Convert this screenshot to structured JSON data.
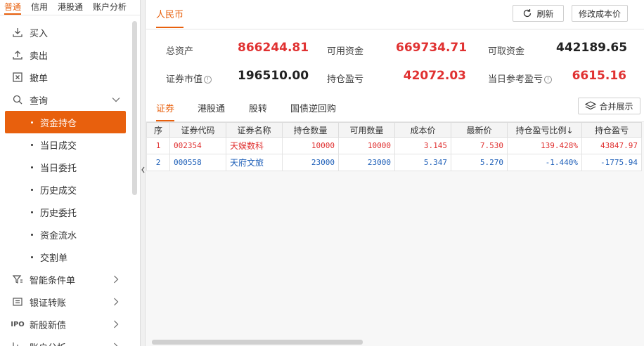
{
  "sidebar": {
    "top_tabs": [
      "普通",
      "信用",
      "港股通",
      "账户分析"
    ],
    "menu": {
      "buy": "买入",
      "sell": "卖出",
      "cancel": "撤单",
      "query": "查询",
      "sub_items": [
        "资金持仓",
        "当日成交",
        "当日委托",
        "历史成交",
        "历史委托",
        "资金流水",
        "交割单"
      ],
      "smart_order": "智能条件单",
      "bank_transfer": "银证转账",
      "ipo": "新股新债",
      "ipo_icon_text": "IPO",
      "account_analysis": "账户分析"
    }
  },
  "header": {
    "currency_tab": "人民币",
    "refresh": "刷新",
    "modify_cost": "修改成本价"
  },
  "summary": {
    "total_assets_label": "总资产",
    "total_assets": "866244.81",
    "available_funds_label": "可用资金",
    "available_funds": "669734.71",
    "withdrawable_label": "可取资金",
    "withdrawable": "442189.65",
    "market_value_label": "证券市值",
    "market_value": "196510.00",
    "position_pl_label": "持仓盈亏",
    "position_pl": "42072.03",
    "today_pl_label": "当日参考盈亏",
    "today_pl": "6615.16"
  },
  "sec_tabs": {
    "tabs": [
      "证券",
      "港股通",
      "股转",
      "国债逆回购"
    ],
    "merge_button": "合并展示"
  },
  "table": {
    "columns": [
      "序",
      "证券代码",
      "证券名称",
      "持仓数量",
      "可用数量",
      "成本价",
      "最新价",
      "持仓盈亏比例↓",
      "持仓盈亏"
    ],
    "rows": [
      {
        "idx": "1",
        "code": "002354",
        "name": "天娱数科",
        "qty": "10000",
        "avail": "10000",
        "cost": "3.145",
        "last": "7.530",
        "ratio": "139.428%",
        "pl": "43847.97",
        "color": "#e03131"
      },
      {
        "idx": "2",
        "code": "000558",
        "name": "天府文旅",
        "qty": "23000",
        "avail": "23000",
        "cost": "5.347",
        "last": "5.270",
        "ratio": "-1.440%",
        "pl": "-1775.94",
        "color": "#1e5fb8"
      }
    ]
  },
  "colors": {
    "accent": "#e8600d",
    "up": "#e03131",
    "down": "#1e5fb8"
  }
}
